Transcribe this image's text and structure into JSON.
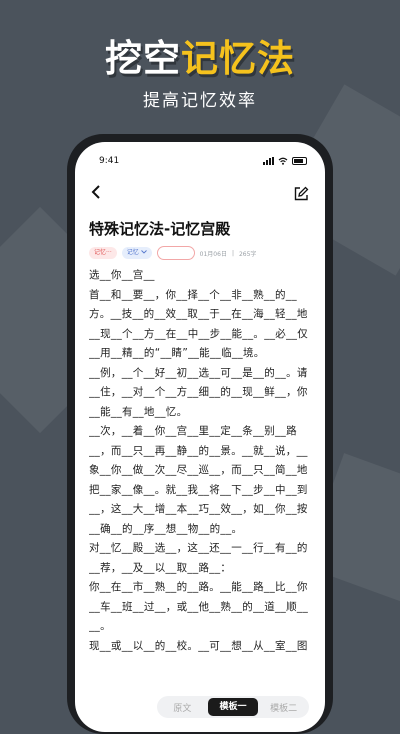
{
  "hero": {
    "title_main": "挖空",
    "title_accent": "记忆法",
    "subtitle": "提高记忆效率"
  },
  "status": {
    "time": "9:41"
  },
  "article": {
    "title": "特殊记忆法-记忆宫殿",
    "tag1": "记忆···",
    "tag2": "记忆",
    "date": "01月06日",
    "separator": "|",
    "word_count": "265字",
    "lines": [
      "选__你__宫__",
      "首__和__要__，你__择__个__非__熟__的__",
      "方。__技__的__效__取__于__在__海__轻__地",
      "__现__个__方__在__中__步__能__。__必__仅",
      "__用__精__的“__睛”__能__临__境。",
      "__例，__个__好__初__选__可__是__的__。请",
      "__住，__对__个__方__细__的__现__鲜__，你",
      "__能__有__地__忆。",
      "__次，__着__你__宫__里__定__条__别__路",
      "__，而__只__再__静__的__景。__就__说，__",
      "象__你__做__次__尽__巡__，而__只__简__地",
      "把__家__像__。就__我__将__下__步__中__到",
      "__，这__大__增__本__巧__效__，如__你__按",
      "__确__的__序__想__物__的__。",
      "对__忆__殿__选__，这__还__一__行__有__的",
      "__荐，__及__以__取__路__：",
      "你__在__市__熟__的__路。__能__路__比__你",
      "__车__班__过__，或__他__熟__的__道__顺__",
      "__。",
      "现__或__以__的__校。__可__想__从__室__图"
    ]
  },
  "tabs": [
    "原文",
    "模板一",
    "模板二"
  ],
  "colors": {
    "accent": "#f5c21d",
    "background": "#4b535c"
  }
}
